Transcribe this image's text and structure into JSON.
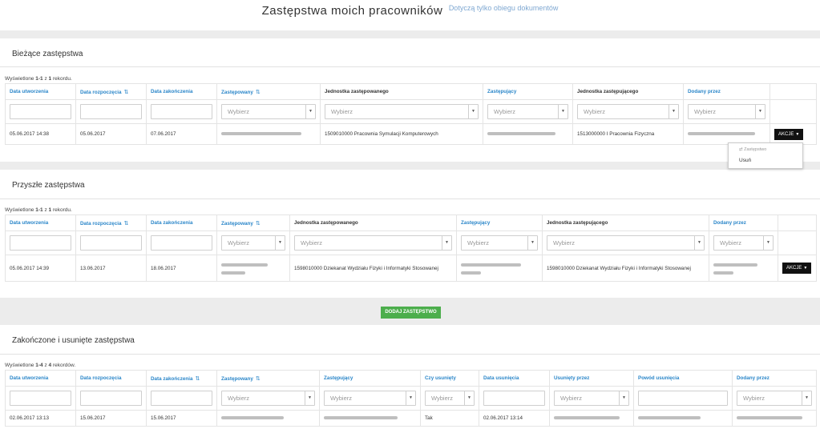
{
  "header": {
    "title": "Zastępstwa moich pracowników",
    "subtitle": "Dotyczą tylko obiegu dokumentów"
  },
  "select_placeholder": "Wybierz",
  "current": {
    "title": "Bieżące zastępstwa",
    "info_prefix": "Wyświetlone ",
    "info_range": "1-1",
    "info_mid": " z ",
    "info_total": "1",
    "info_suffix": " rekordu.",
    "columns": [
      "Data utworzenia",
      "Data rozpoczęcia",
      "Data zakończenia",
      "Zastępowany",
      "Jednostka zastępowanego",
      "Zastępujący",
      "Jednostka zastępującego",
      "Dodany przez"
    ],
    "row": {
      "created": "05.06.2017 14:38",
      "start": "05.06.2017",
      "end": "07.06.2017",
      "unit_replaced": "1509010000 Pracownia Symulacji Komputerowych",
      "unit_replacing": "1513000000 I Pracownia Fizyczna",
      "actions": "AKCJE"
    },
    "menu": {
      "item1": "Zastępstwo",
      "item2": "Usuń"
    }
  },
  "future": {
    "title": "Przyszłe zastępstwa",
    "info_prefix": "Wyświetlone ",
    "info_range": "1-1",
    "info_mid": " z ",
    "info_total": "1",
    "info_suffix": " rekordu.",
    "columns": [
      "Data utworzenia",
      "Data rozpoczęcia",
      "Data zakończenia",
      "Zastępowany",
      "Jednostka zastępowanego",
      "Zastępujący",
      "Jednostka zastępującego",
      "Dodany przez"
    ],
    "row": {
      "created": "05.06.2017 14:39",
      "start": "13.06.2017",
      "end": "18.06.2017",
      "unit_replaced": "1598010000 Dziekanat Wydziału Fizyki i Informatyki Stosowanej",
      "unit_replacing": "1598010000 Dziekanat Wydziału Fizyki i Informatyki Stosowanej",
      "actions": "AKCJE"
    }
  },
  "add_button": "DODAJ ZASTĘPSTWO",
  "finished": {
    "title": "Zakończone i usunięte zastępstwa",
    "info_prefix": "Wyświetlone ",
    "info_range": "1-4",
    "info_mid": " z ",
    "info_total": "4",
    "info_suffix": " rekordów.",
    "columns": [
      "Data utworzenia",
      "Data rozpoczęcia",
      "Data zakończenia",
      "Zastępowany",
      "Zastępujący",
      "Czy usunięty",
      "Data usunięcia",
      "Usunięty przez",
      "Powód usunięcia",
      "Dodany przez"
    ],
    "row": {
      "created": "02.06.2017 13:13",
      "start": "15.06.2017",
      "end": "15.06.2017",
      "deleted": "Tak",
      "deleted_date": "02.06.2017 13:14"
    }
  },
  "colors": {
    "link": "#2a86c9",
    "add_button": "#4cae4c",
    "actions_button": "#111111"
  }
}
